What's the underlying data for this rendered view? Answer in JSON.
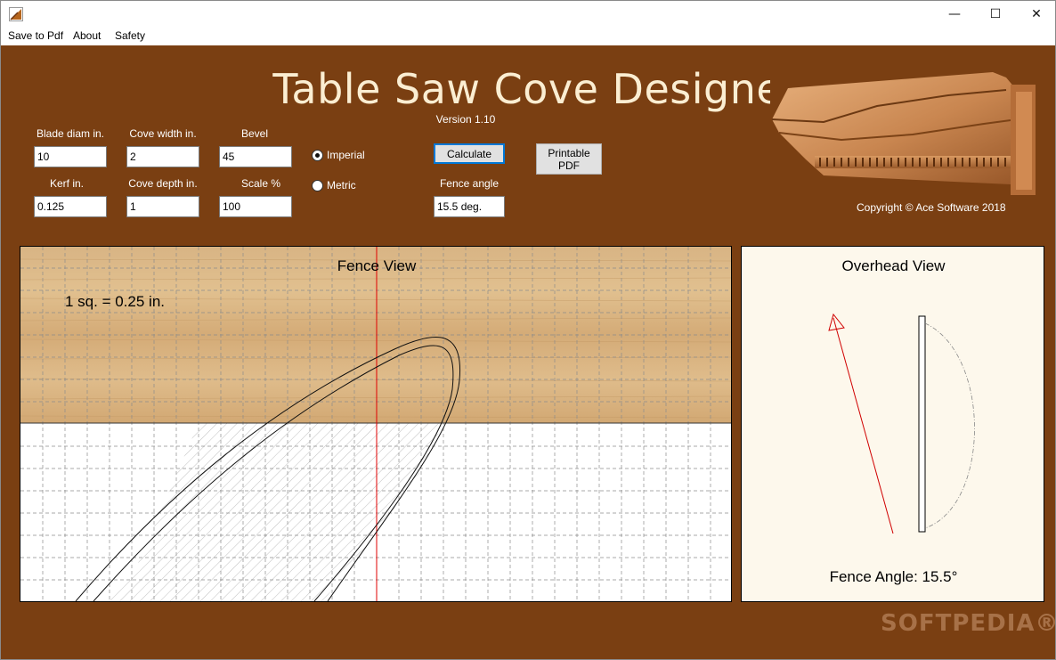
{
  "window": {
    "icons": {
      "app": "saw-cove-app-icon",
      "minimize": "minimize-icon",
      "maximize": "maximize-icon",
      "close": "close-icon"
    },
    "min_glyph": "—",
    "max_glyph": "☐",
    "close_glyph": "✕"
  },
  "menu": {
    "items": [
      "Save to Pdf",
      "About",
      "Safety"
    ]
  },
  "header": {
    "title": "Table Saw Cove Designer",
    "version": "Version 1.10",
    "copyright": "Copyright © Ace Software 2018"
  },
  "inputs": {
    "blade_diam": {
      "label": "Blade diam in.",
      "value": "10"
    },
    "cove_width": {
      "label": "Cove width in.",
      "value": "2"
    },
    "bevel": {
      "label": "Bevel",
      "value": "45"
    },
    "kerf": {
      "label": "Kerf in.",
      "value": "0.125"
    },
    "cove_depth": {
      "label": "Cove depth in.",
      "value": "1"
    },
    "scale": {
      "label": "Scale %",
      "value": "100"
    }
  },
  "units": {
    "options": [
      "Imperial",
      "Metric"
    ],
    "selected": "Imperial"
  },
  "actions": {
    "calculate": "Calculate",
    "printable_pdf_line1": "Printable",
    "printable_pdf_line2": "PDF"
  },
  "fence_angle": {
    "label": "Fence angle",
    "value": "15.5 deg."
  },
  "fence_view": {
    "title": "Fence View",
    "scale_note": "1 sq. = 0.25 in.",
    "colors": {
      "wood": "#d9b586",
      "grid": "#8c8c8c",
      "marker_line": "#e00000"
    }
  },
  "overhead_view": {
    "title": "Overhead View",
    "angle_readout": "Fence Angle: 15.5°",
    "colors": {
      "background": "#fdf8ec",
      "fence_line": "#d00000"
    }
  },
  "watermark": "SOFTPEDIA®",
  "theme": {
    "workspace_bg": "#7a3f12",
    "title_color": "#fbeed2"
  }
}
